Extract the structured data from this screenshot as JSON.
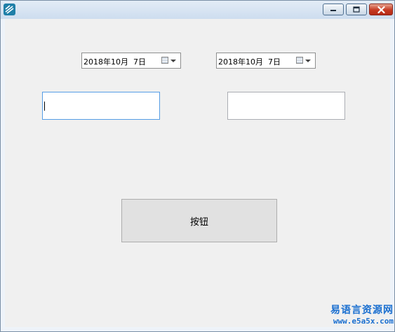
{
  "window": {
    "title": ""
  },
  "controls": {
    "date_picker_1": {
      "value": "2018年10月  7日"
    },
    "date_picker_2": {
      "value": "2018年10月  7日"
    },
    "text_box_1": {
      "value": ""
    },
    "text_box_2": {
      "value": ""
    },
    "button": {
      "label": "按钮"
    }
  },
  "watermark": {
    "name": "易语言资源网",
    "url": "www.e5a5x.com"
  },
  "icons": {
    "app": "app-icon",
    "minimize": "minimize-icon",
    "maximize": "maximize-icon",
    "close": "close-icon",
    "calendar": "calendar-icon",
    "dropdown": "chevron-down-icon"
  },
  "colors": {
    "client_background": "#f0f0f0",
    "focus_border": "#569de5",
    "close_button": "#c63a22",
    "watermark": "#1a6fd0"
  }
}
